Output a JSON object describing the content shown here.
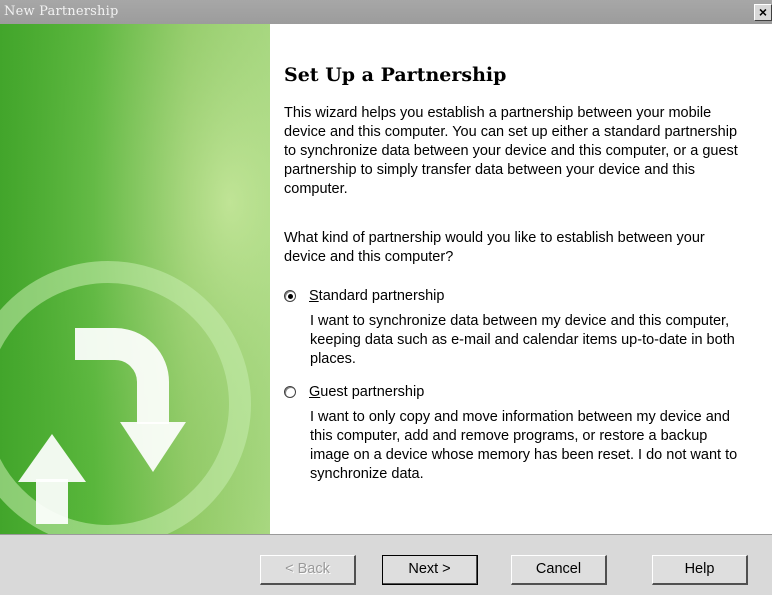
{
  "window": {
    "title": "New Partnership",
    "close_glyph": "×"
  },
  "main": {
    "heading": "Set Up a Partnership",
    "intro": "This wizard helps you establish a partnership between your mobile device and this computer.  You can set up either a standard partnership to synchronize data between your device and this computer, or a guest partnership to simply transfer data between your device and this computer.",
    "question": "What kind of partnership would you like to establish between your device and this computer?",
    "options": [
      {
        "accel": "S",
        "label_rest": "tandard partnership",
        "selected": true,
        "description": "I want to synchronize data between my device and this computer, keeping data such as e-mail and calendar items up-to-date in both places."
      },
      {
        "accel": "G",
        "label_rest": "uest partnership",
        "selected": false,
        "description": "I want to only copy and move information between my device and this computer, add and remove programs, or restore a backup image on a device whose memory has been reset. I do not want to synchronize data."
      }
    ]
  },
  "buttons": {
    "back": "< Back",
    "next": "Next >",
    "cancel": "Cancel",
    "help": "Help"
  },
  "side_panel": {
    "icon": "sync-arrows-icon",
    "colors": {
      "dark_green": "#42a52b",
      "light_green": "#b8e08d"
    }
  }
}
